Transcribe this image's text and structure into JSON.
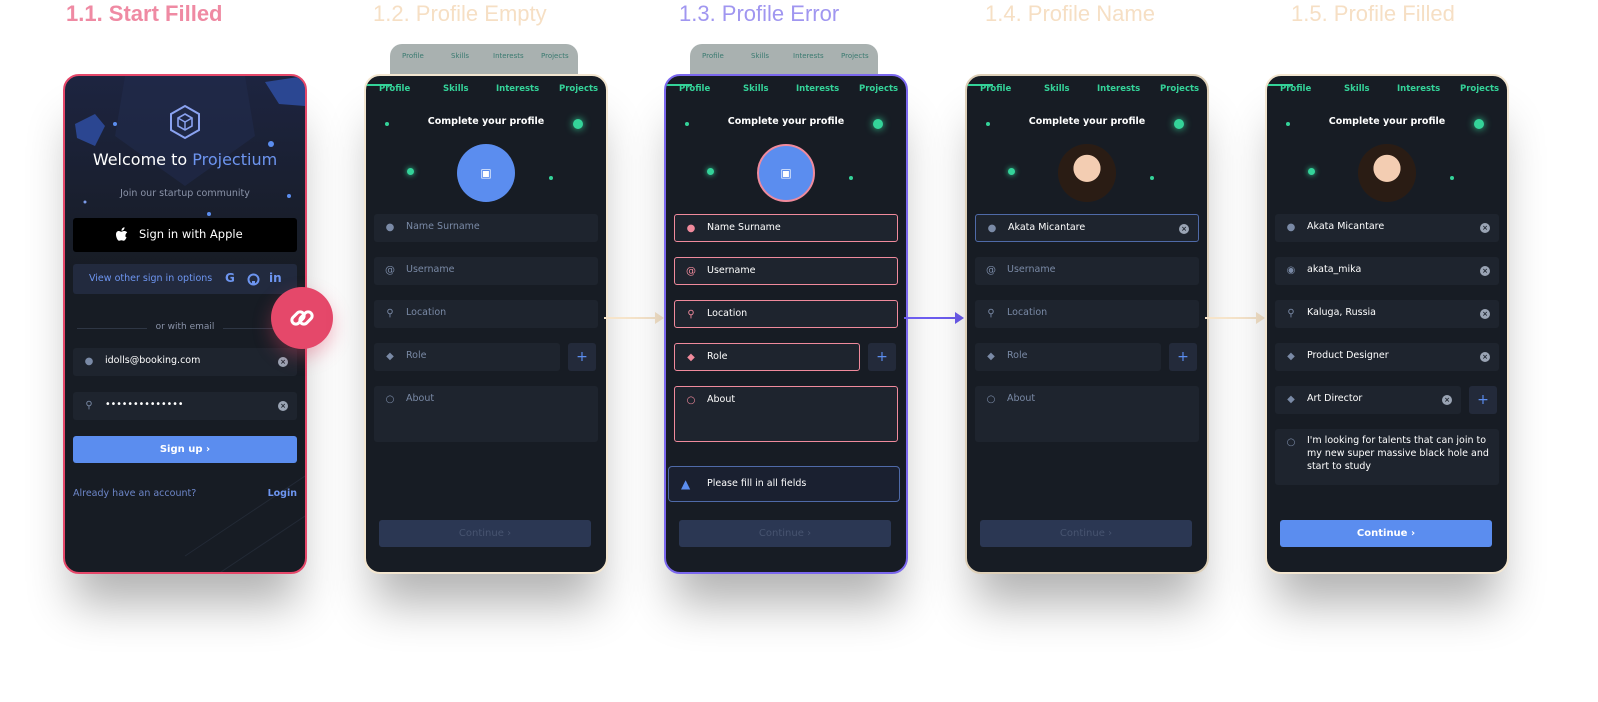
{
  "screen_titles": [
    "1.1. Start Filled",
    "1.2. Profile Empty",
    "1.3. Profile Error",
    "1.4. Profile Name",
    "1.5. Profile Filled"
  ],
  "tabs": [
    "Profile",
    "Skills",
    "Interests",
    "Projects"
  ],
  "start": {
    "welcome": "Welcome to",
    "brand": "Projectium",
    "subtitle": "Join our startup community",
    "apple_button": "Sign in with Apple",
    "other_options": "View other sign in options",
    "or_email": "or with email",
    "email_value": "idolls@booking.com",
    "password_value": "••••••••••••••",
    "signup_button": "Sign up",
    "have_account": "Already have an account?",
    "login_link": "Login"
  },
  "profile": {
    "title": "Complete your profile",
    "placeholders": {
      "name": "Name Surname",
      "username": "Username",
      "location": "Location",
      "role": "Role",
      "about": "About"
    },
    "continue_button": "Continue",
    "error_message": "Please fill in all fields"
  },
  "filled": {
    "name": "Akata Micantare",
    "username": "akata_mika",
    "location": "Kaluga, Russia",
    "role1": "Product Designer",
    "role2": "Art Director",
    "about": "I'm looking for talents that can join to my new super massive black hole and start to study"
  },
  "icons": {
    "person": "person-icon",
    "at": "at-sign-icon",
    "pin": "location-pin-icon",
    "gem": "gem-icon",
    "chat": "chat-bubble-icon",
    "image": "image-icon",
    "clear": "clear-x-icon",
    "link": "link-icon",
    "warning": "warning-triangle-icon"
  },
  "colors": {
    "background": "#171c24",
    "field": "#1e242e",
    "accent_blue": "#5b8def",
    "accent_green": "#34d399",
    "error_red": "#f08a9c",
    "link_button": "#e5486a"
  }
}
